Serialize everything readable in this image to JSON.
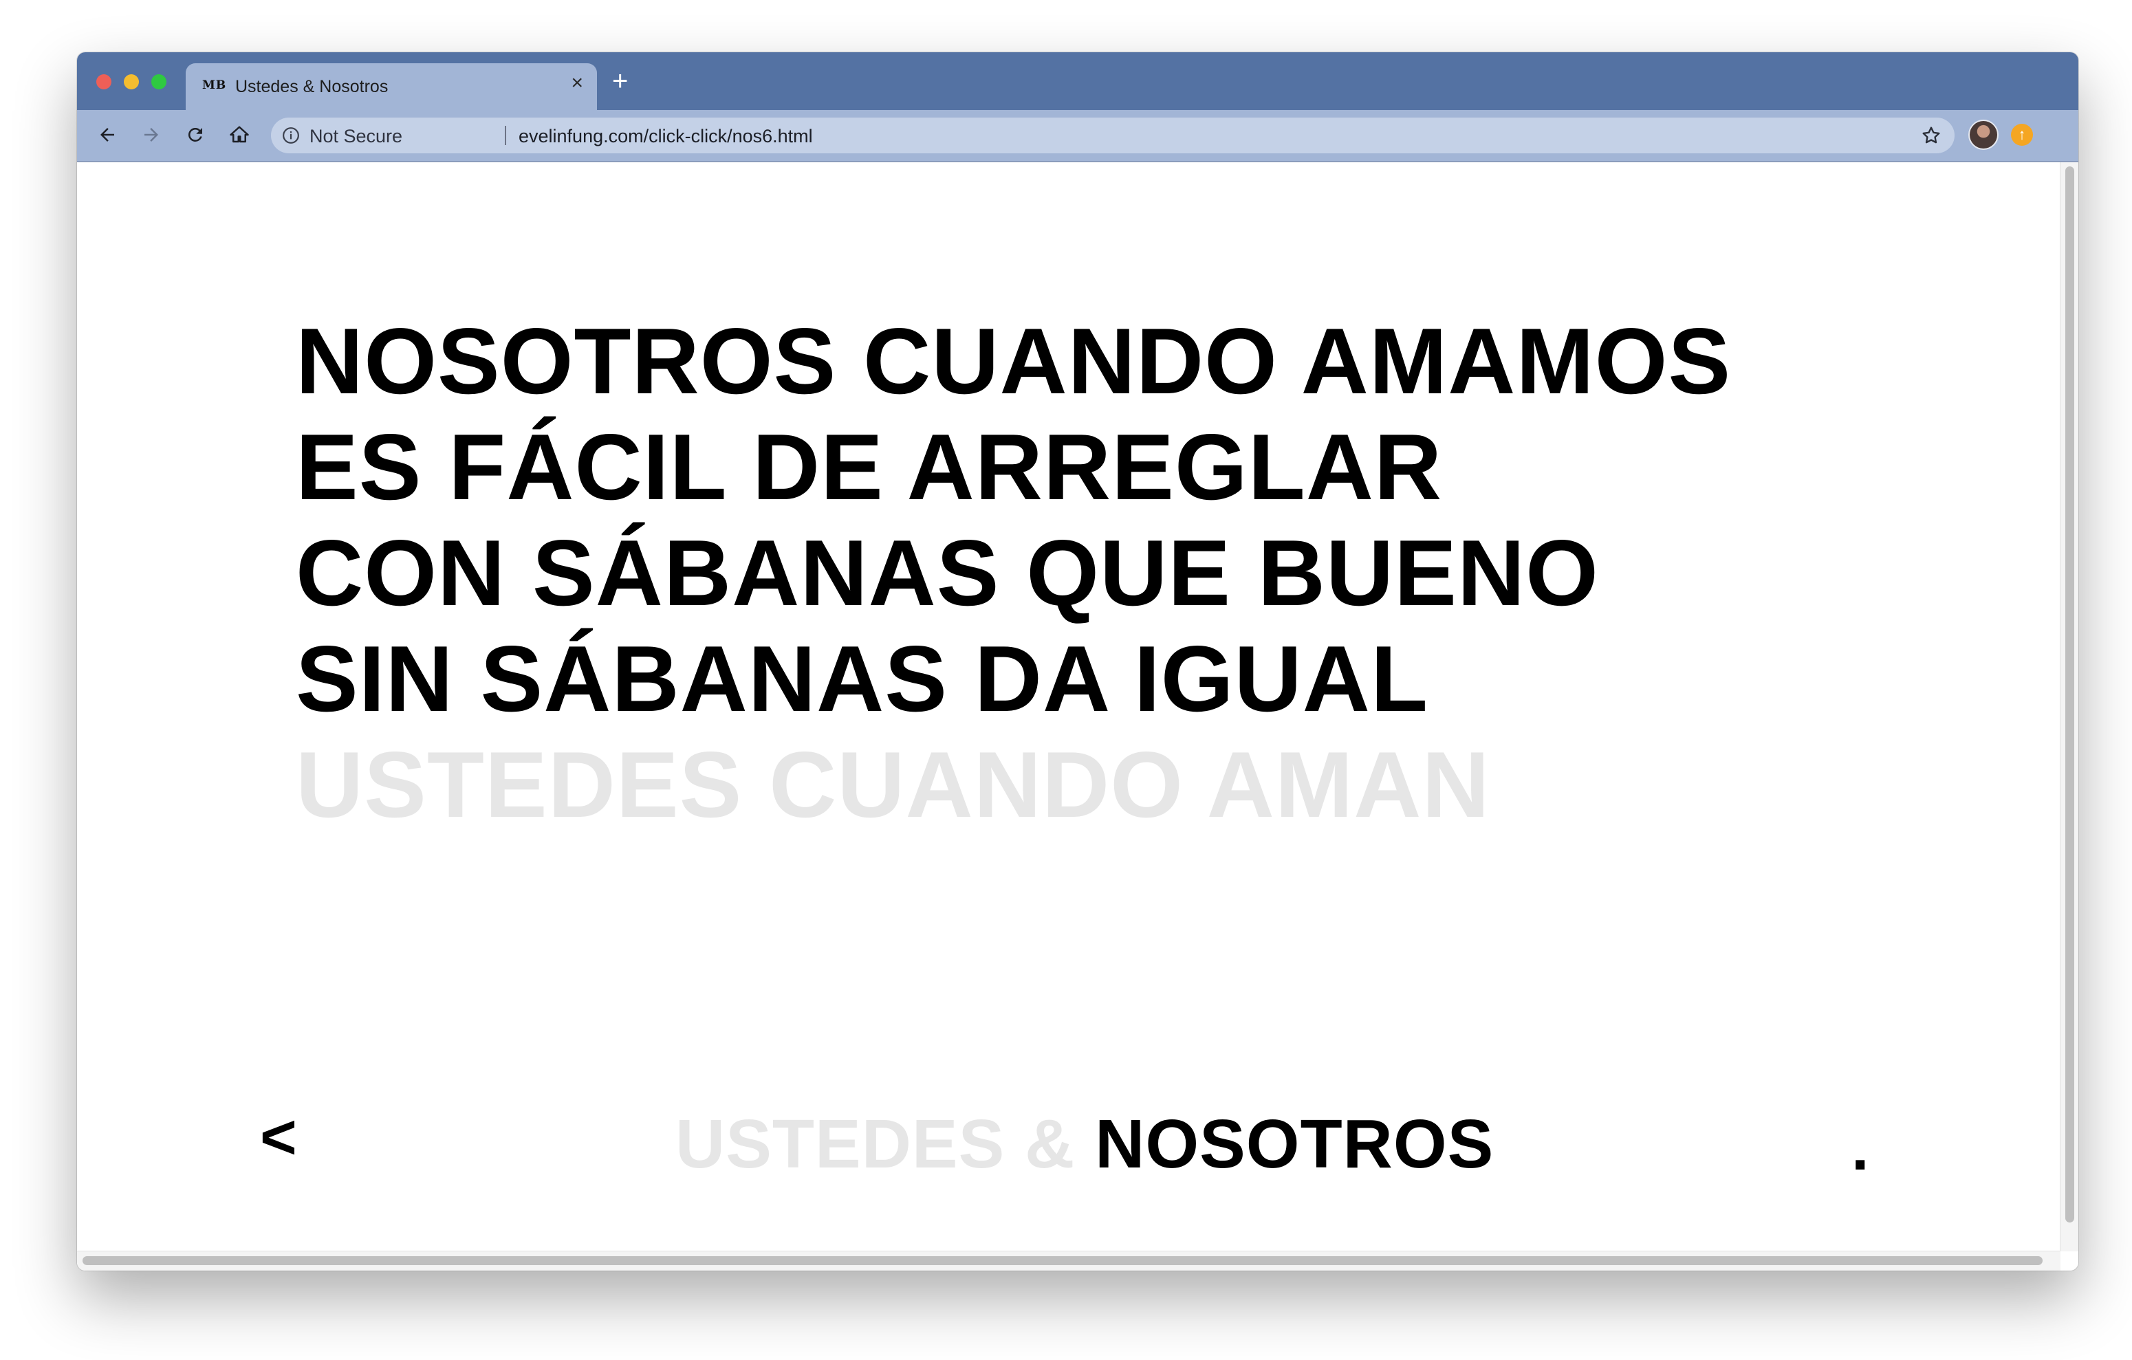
{
  "browser": {
    "tab": {
      "favicon_text": "MB",
      "title": "Ustedes & Nosotros",
      "close_glyph": "×"
    },
    "new_tab_glyph": "+",
    "omnibox": {
      "security_label": "Not Secure",
      "url": "evelinfung.com/click-click/nos6.html"
    },
    "icons": {
      "back": "arrow-left-icon",
      "forward": "arrow-right-icon",
      "reload": "reload-icon",
      "home": "home-icon",
      "info": "info-icon",
      "bookmark": "star-icon",
      "profile": "avatar",
      "update": "update-icon"
    },
    "update_glyph": "↑"
  },
  "page": {
    "lines": [
      {
        "text": "NOSOTROS CUANDO AMAMOS",
        "color": "#000000"
      },
      {
        "text": "ES FÁCIL DE ARREGLAR",
        "color": "#000000"
      },
      {
        "text": "CON SÁBANAS QUE BUENO",
        "color": "#000000"
      },
      {
        "text": "SIN SÁBANAS DA IGUAL",
        "color": "#000000"
      },
      {
        "text": "USTEDES CUANDO AMAN",
        "color": "#e6e6e6"
      }
    ],
    "footer": {
      "prev_label": "<",
      "title_part1": "USTEDES & ",
      "title_part2": "NOSOTROS",
      "end_mark": "."
    }
  },
  "colors": {
    "tab_strip": "#5472a3",
    "toolbar": "#a2b5d6",
    "text_dark": "#000000",
    "text_faded": "#e6e6e6"
  }
}
